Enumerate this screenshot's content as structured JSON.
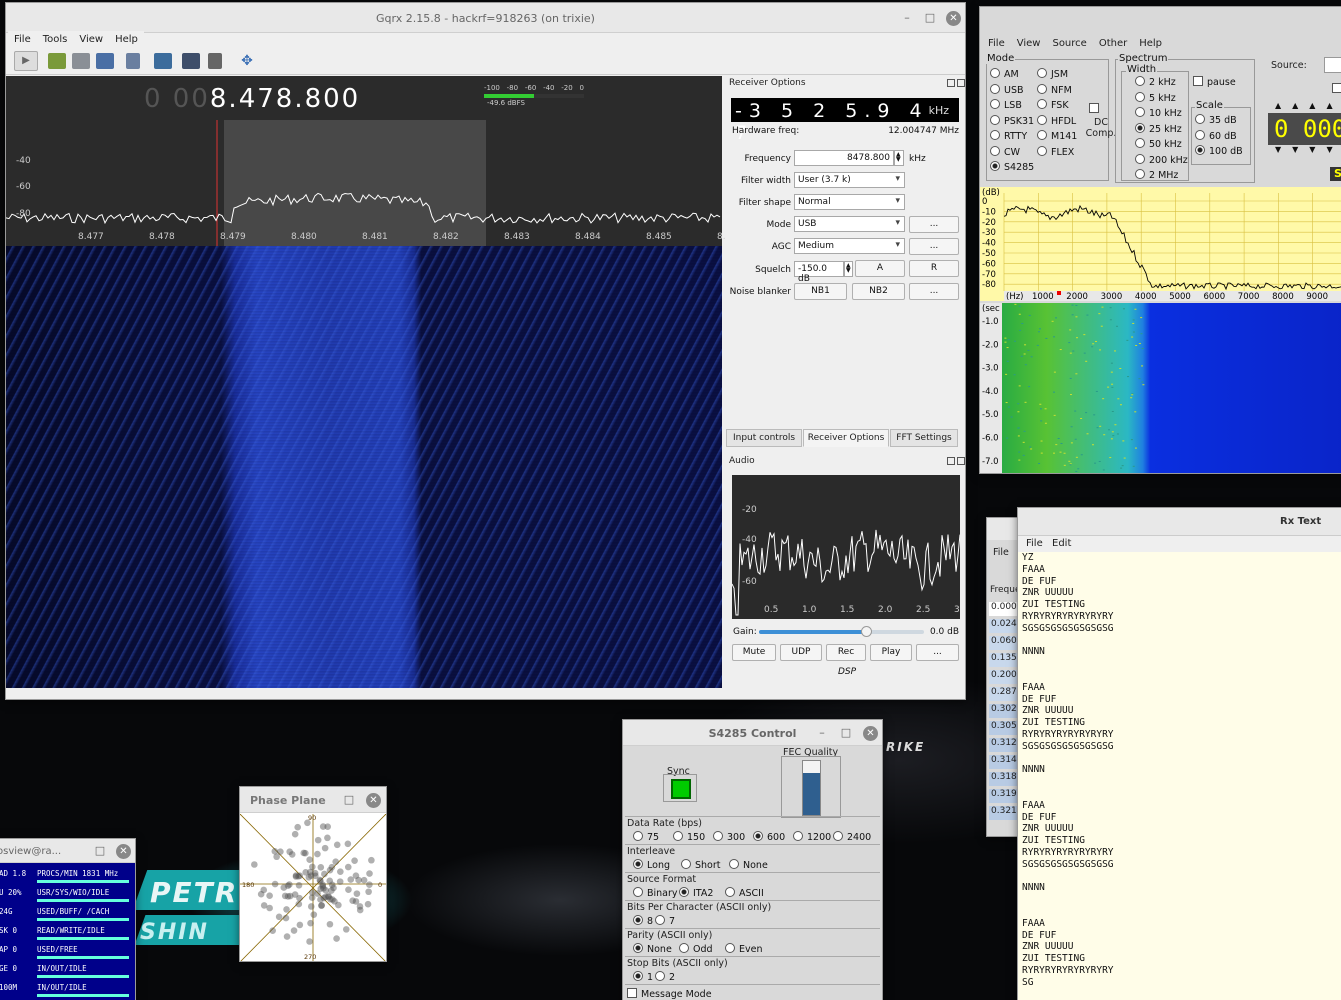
{
  "gqrx": {
    "title": "Gqrx 2.15.8 - hackrf=918263 (on trixie)",
    "menu": [
      "File",
      "Tools",
      "View",
      "Help"
    ],
    "freq_dim": "0 00",
    "freq_main": "8.478.800",
    "meter_ticks": [
      "-100",
      "-80",
      "-60",
      "-40",
      "-20",
      "0"
    ],
    "meter_value": "-49.6 dBFS",
    "plot_y_labels": [
      "-40",
      "-60",
      "-80"
    ],
    "plot_x_labels": [
      "8.477",
      "8.478",
      "8.479",
      "8.480",
      "8.481",
      "8.482",
      "8.483",
      "8.484",
      "8.485",
      "8."
    ],
    "receiver": {
      "title": "Receiver Options",
      "offset_digits": "-3 5 2 5.9 4 7",
      "offset_unit": "kHz",
      "hw_label": "Hardware freq:",
      "hw_value": "12.004747 MHz",
      "frequency_label": "Frequency",
      "frequency_value": "8478.800",
      "frequency_unit": "kHz",
      "filter_width_label": "Filter width",
      "filter_width_value": "User (3.7 k)",
      "filter_shape_label": "Filter shape",
      "filter_shape_value": "Normal",
      "mode_label": "Mode",
      "mode_value": "USB",
      "agc_label": "AGC",
      "agc_value": "Medium",
      "squelch_label": "Squelch",
      "squelch_value": "-150.0 dB",
      "squelch_a": "A",
      "squelch_r": "R",
      "noise_label": "Noise blanker",
      "nb1": "NB1",
      "nb2": "NB2",
      "more": "..."
    },
    "tabs": [
      "Input controls",
      "Receiver Options",
      "FFT Settings"
    ],
    "audio": {
      "title": "Audio",
      "y_labels": [
        "-20",
        "-40",
        "-60"
      ],
      "x_labels": [
        "0.5",
        "1.0",
        "1.5",
        "2.0",
        "2.5",
        "3"
      ],
      "gain_label": "Gain:",
      "gain_value": "0.0 dB",
      "gain_level": 0.65,
      "buttons": [
        "Mute",
        "UDP",
        "Rec",
        "Play",
        "..."
      ],
      "dsp": "DSP"
    }
  },
  "sigwin": {
    "menu": [
      "File",
      "View",
      "Source",
      "Other",
      "Help"
    ],
    "mode_title": "Mode",
    "modes_left": [
      "AM",
      "USB",
      "LSB",
      "PSK31",
      "RTTY",
      "CW",
      "S4285"
    ],
    "modes_right": [
      "JSM",
      "NFM",
      "FSK",
      "HFDL",
      "M141",
      "FLEX"
    ],
    "mode_selected": "S4285",
    "dc_comp": "DC Comp.",
    "spectrum_title": "Spectrum",
    "width_title": "Width",
    "widths": [
      "2 kHz",
      "5 kHz",
      "10 kHz",
      "25 kHz",
      "50 kHz",
      "200 kHz",
      "2 MHz"
    ],
    "width_selected": "25 kHz",
    "pause": "pause",
    "scale_title": "Scale",
    "scales": [
      "35 dB",
      "60 dB",
      "100 dB"
    ],
    "scale_selected": "100 dB",
    "source_label": "Source:",
    "big_freq": "0 000",
    "side_letter": "S",
    "spec_y_labels": [
      "0",
      "-10",
      "-20",
      "-30",
      "-40",
      "-50",
      "-60",
      "-70",
      "-80"
    ],
    "spec_y_unit": "(dB)",
    "spec_x_unit": "(Hz)",
    "spec_x_labels": [
      "1000",
      "2000",
      "3000",
      "4000",
      "5000",
      "6000",
      "7000",
      "8000",
      "9000",
      "1"
    ],
    "wf_unit": "(sec",
    "wf_labels": [
      "-1.0",
      "-2.0",
      "-3.0",
      "-4.0",
      "-5.0",
      "-6.0",
      "-7.0"
    ]
  },
  "rxtext": {
    "title": "Rx Text",
    "menu": [
      "File",
      "Edit"
    ],
    "lines": [
      "YZ",
      "FAAA",
      "DE FUF",
      "ZNR UUUUU",
      "ZUI TESTING",
      "RYRYRYRYRYRYRYRY",
      "SGSGSGSGSGSGSGSG",
      "",
      "NNNN",
      "",
      "",
      "FAAA",
      "DE FUF",
      "ZNR UUUUU",
      "ZUI TESTING",
      "RYRYRYRYRYRYRYRY",
      "SGSGSGSGSGSGSGSG",
      "",
      "NNNN",
      "",
      "",
      "FAAA",
      "DE FUF",
      "ZNR UUUUU",
      "ZUI TESTING",
      "RYRYRYRYRYRYRYRY",
      "SGSGSGSGSGSGSGSG",
      "",
      "NNNN",
      "",
      "",
      "FAAA",
      "DE FUF",
      "ZNR UUUUU",
      "ZUI TESTING",
      "RYRYRYRYRYRYRYRY",
      "SG"
    ]
  },
  "flist": {
    "menu": "File",
    "header": "Freque",
    "rows": [
      "0.0000",
      "0.0248",
      "0.0600",
      "0.1350",
      "0.2000",
      "0.2870",
      "0.3020",
      "0.3050",
      "0.3120",
      "0.3140",
      "0.3180",
      "0.3190",
      "0.3210"
    ]
  },
  "s4285": {
    "title": "S4285 Control",
    "sync": "Sync",
    "fec": "FEC Quality",
    "fec_level": 0.78,
    "data_rate_title": "Data Rate (bps)",
    "data_rates": [
      "75",
      "150",
      "300",
      "600",
      "1200",
      "2400"
    ],
    "data_rate_selected": "600",
    "interleave_title": "Interleave",
    "interleaves": [
      "Long",
      "Short",
      "None"
    ],
    "interleave_selected": "Long",
    "source_format_title": "Source Format",
    "formats": [
      "Binary",
      "ITA2",
      "ASCII"
    ],
    "format_selected": "ITA2",
    "bpc_title": "Bits Per Character  (ASCII only)",
    "bpcs": [
      "8",
      "7"
    ],
    "bpc_selected": "8",
    "parity_title": "Parity  (ASCII only)",
    "parities": [
      "None",
      "Odd",
      "Even"
    ],
    "parity_selected": "None",
    "stop_title": "Stop Bits  (ASCII only)",
    "stops": [
      "1",
      "2"
    ],
    "stop_selected": "1",
    "message_mode": "Message Mode"
  },
  "phase": {
    "title": "Phase Plane",
    "labels": [
      "90",
      "180",
      "0",
      "270"
    ]
  },
  "sysmon": {
    "title": "osview@ra...",
    "rows": [
      {
        "left": "AD  1.8",
        "right": "PROCS/MIN 1831 MHz"
      },
      {
        "left": "U   20%",
        "right": "USR/SYS/WIO/IDLE"
      },
      {
        "left": "   24G",
        "right": "USED/BUFF/   /CACH"
      },
      {
        "left": "SK    0",
        "right": "READ/WRITE/IDLE"
      },
      {
        "left": "AP    0",
        "right": "USED/FREE"
      },
      {
        "left": "GE    0",
        "right": "IN/OUT/IDLE"
      },
      {
        "left": "   100M",
        "right": "IN/OUT/IDLE"
      }
    ]
  },
  "colors": {
    "waterfall_accent": "#2847c8",
    "spectrum_bg": "#fff9a8",
    "sync_green": "#00cc00",
    "fec_blue": "#2f5f8f",
    "big_freq": "#ffff00"
  },
  "car": {
    "text1": "PETR",
    "text2": "SHIN",
    "text3": "RIKE"
  }
}
